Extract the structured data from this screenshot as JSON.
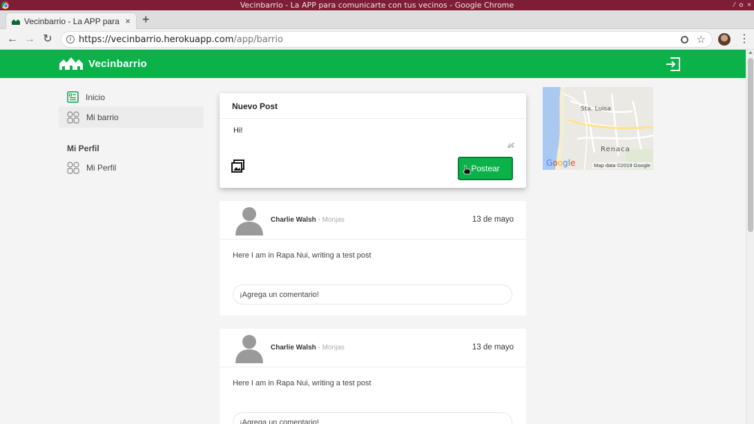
{
  "window": {
    "title": "Vecinbarrio - La APP para comunicarte con tus vecinos - Google Chrome",
    "controls": [
      "⁄",
      "o",
      "×"
    ]
  },
  "browser": {
    "tab_title": "Vecinbarrio - La APP para c",
    "tab_close": "×",
    "new_tab": "+",
    "url_host": "https://vecinbarrio.herokuapp.com",
    "url_path": "/app/barrio",
    "back": "←",
    "forward": "→",
    "reload": "↻",
    "star": "☆",
    "menu": "⋮"
  },
  "app": {
    "brand": "Vecinbarrio",
    "accent_color": "#0bb24a"
  },
  "sidebar": {
    "items": [
      {
        "label": "Inicio",
        "icon": "document-list-icon"
      },
      {
        "label": "Mi barrio",
        "icon": "grid-circles-icon"
      }
    ],
    "profile_heading": "Mi Perfil",
    "profile_items": [
      {
        "label": "Mi Perfil",
        "icon": "grid-circles-icon"
      }
    ]
  },
  "new_post": {
    "title": "Nuevo Post",
    "text": "Hi!",
    "button": "Postear"
  },
  "posts": [
    {
      "author": "Charlie Walsh",
      "separator": " - ",
      "neighborhood": "Monjas",
      "date": "13 de mayo",
      "body": "Here I am in Rapa Nui, writing a test post",
      "comment_placeholder": "¡Agrega un comentario!"
    },
    {
      "author": "Charlie Walsh",
      "separator": " - ",
      "neighborhood": "Monjas",
      "date": "13 de mayo",
      "body": "Here I am in Rapa Nui, writing a test post",
      "comment_placeholder": "¡Agrega un comentario!"
    }
  ],
  "map": {
    "labels": [
      "Sta. Luisa",
      "Renaca"
    ],
    "google": "Google",
    "attribution": "Map data ©2019 Google"
  }
}
